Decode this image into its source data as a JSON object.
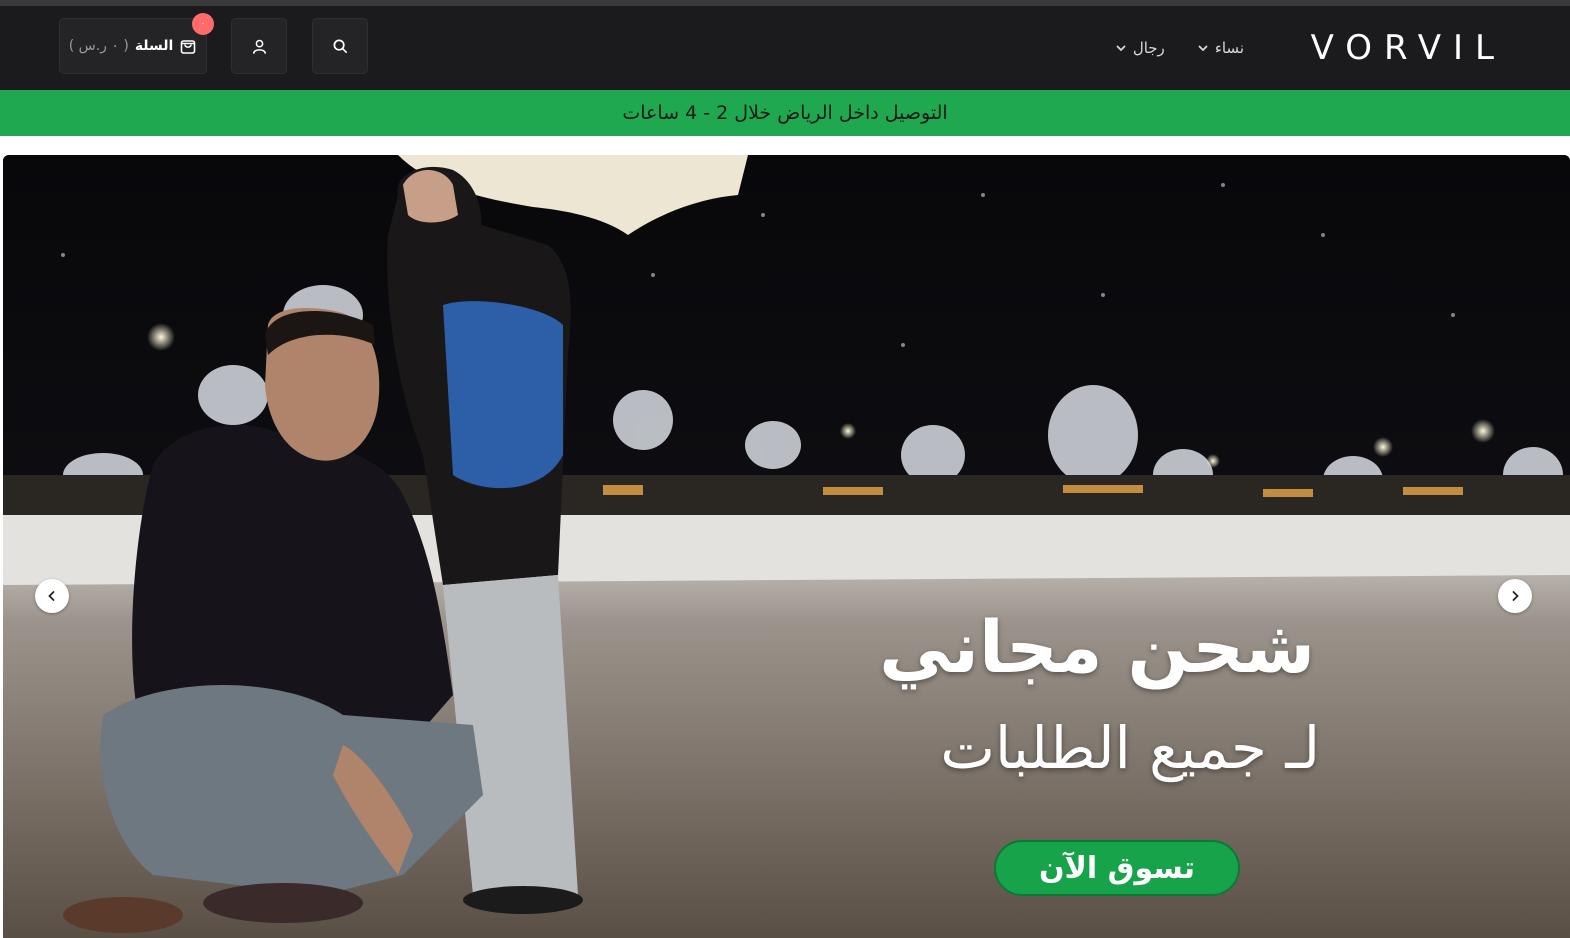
{
  "header": {
    "logo": "VORVIL",
    "nav": [
      {
        "label": "رجال"
      },
      {
        "label": "نساء"
      }
    ],
    "cart": {
      "label": "السلة",
      "total": "( ٠ ر.س )",
      "badge": "٠"
    }
  },
  "banner": {
    "text": "التوصيل داخل الرياض خلال 2 - 4 ساعات"
  },
  "hero": {
    "headline": "شحن مجاني",
    "subline": "لـ جميع الطلبات",
    "cta": "تسوق الآن"
  },
  "colors": {
    "header_bg": "#1b1b1d",
    "banner_bg": "#1fa84f",
    "cta_bg": "#17a34a",
    "badge": "#ff6b6b"
  },
  "icons": [
    "search-icon",
    "user-icon",
    "shopping-bag-icon",
    "chevron-down-icon",
    "chevron-left-icon",
    "chevron-right-icon"
  ]
}
